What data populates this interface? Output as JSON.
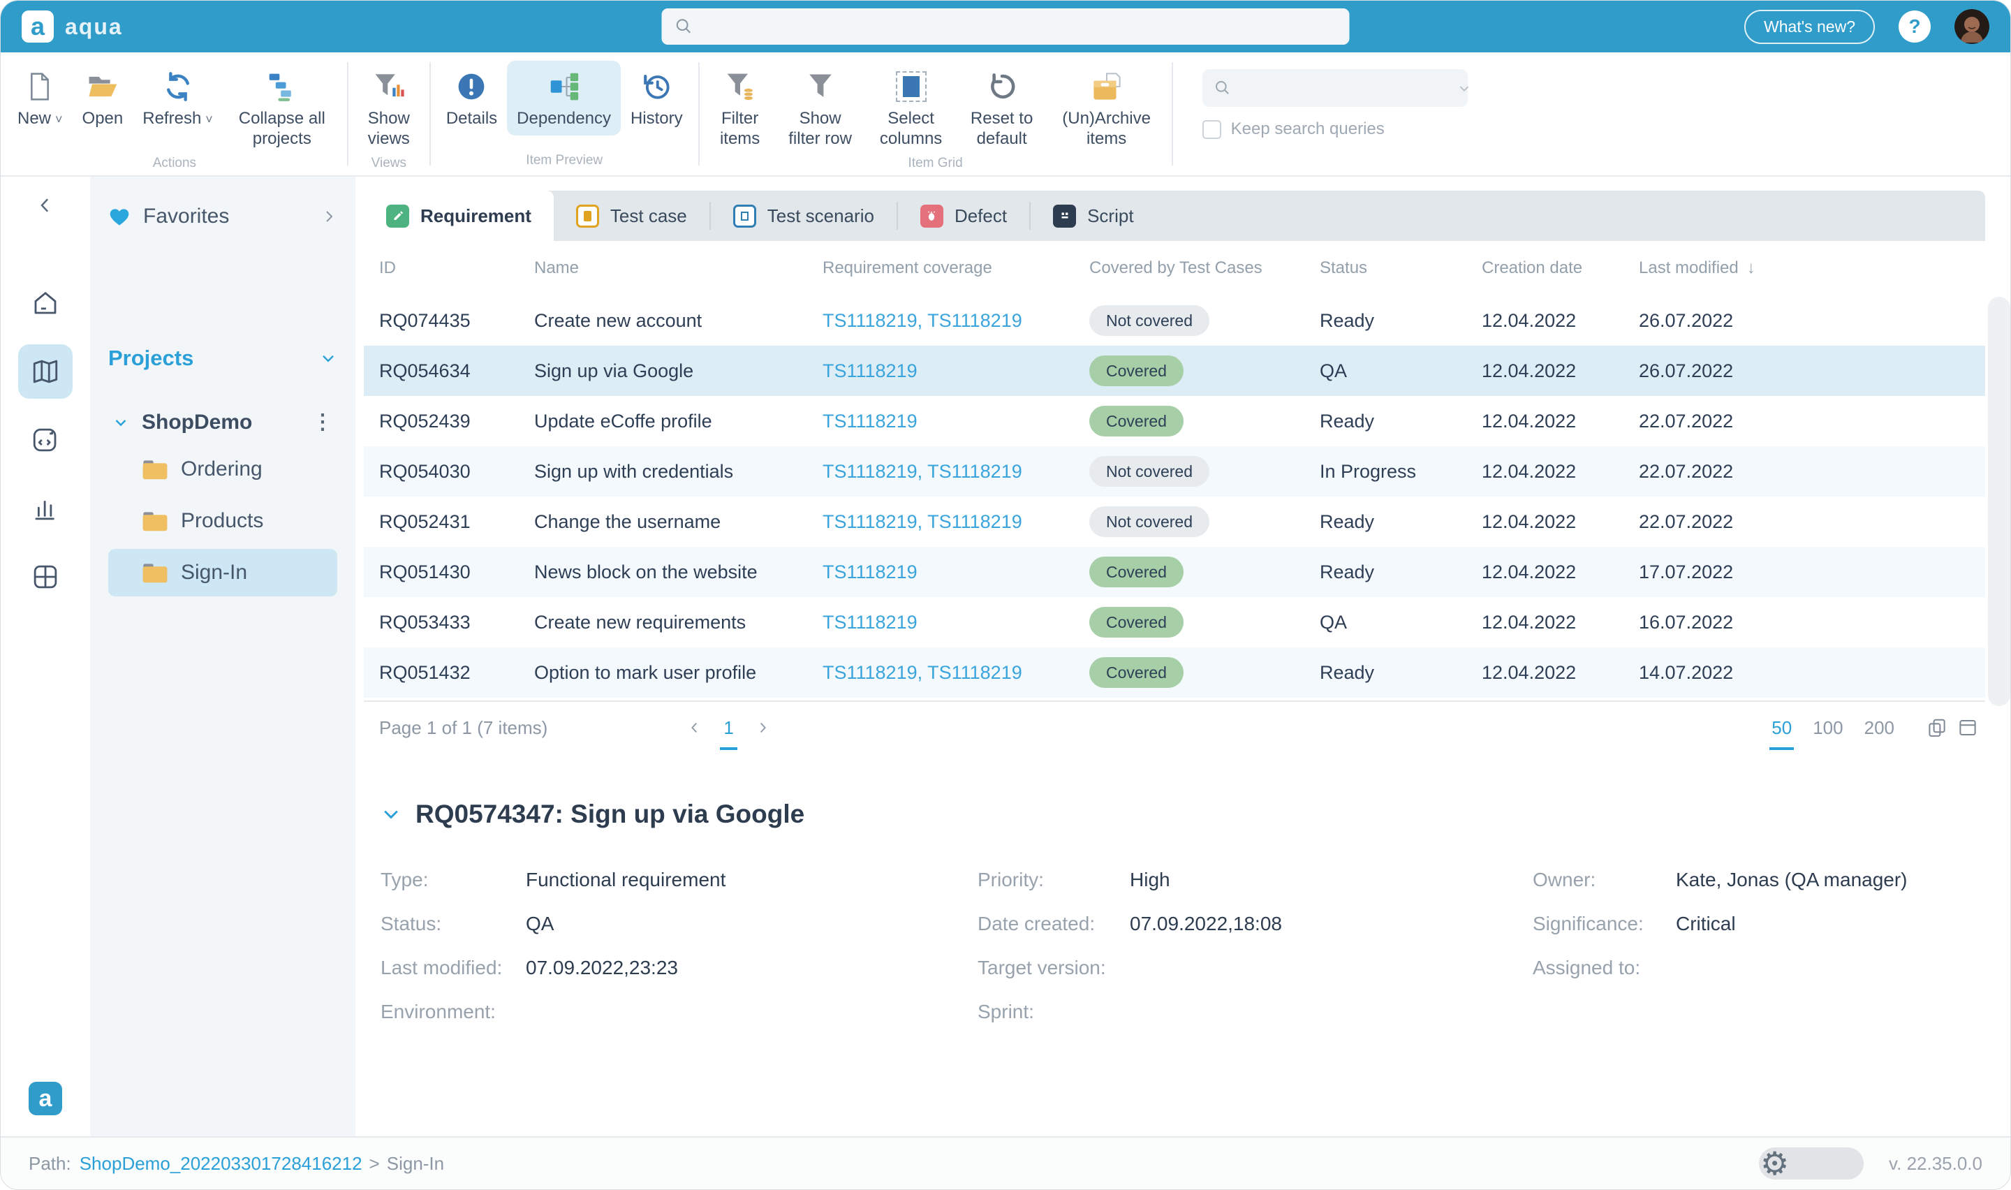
{
  "topbar": {
    "brand": "aqua",
    "search_placeholder": "",
    "whats_new_label": "What's new?",
    "help_label": "?"
  },
  "toolbar": {
    "groups": [
      {
        "label": "Actions",
        "buttons": [
          {
            "label": "New"
          },
          {
            "label": "Open"
          },
          {
            "label": "Refresh"
          },
          {
            "label": "Collapse all projects"
          }
        ]
      },
      {
        "label": "Views",
        "buttons": [
          {
            "label": "Show views"
          }
        ]
      },
      {
        "label": "Item Preview",
        "buttons": [
          {
            "label": "Details"
          },
          {
            "label": "Dependency"
          },
          {
            "label": "History"
          }
        ]
      },
      {
        "label": "Item Grid",
        "buttons": [
          {
            "label": "Filter items"
          },
          {
            "label": "Show filter row"
          },
          {
            "label": "Select columns"
          },
          {
            "label": "Reset to default"
          },
          {
            "label": "(Un)Archive items"
          }
        ]
      }
    ],
    "search_placeholder": "",
    "keep_search_label": "Keep search queries"
  },
  "sidebar": {
    "favorites_label": "Favorites",
    "projects_label": "Projects",
    "tree": {
      "project": "ShopDemo",
      "folders": [
        {
          "label": "Ordering",
          "state": "default"
        },
        {
          "label": "Products",
          "state": "default"
        },
        {
          "label": "Sign-In",
          "state": "selected"
        }
      ]
    }
  },
  "tabs": [
    {
      "label": "Requirement",
      "state": "active"
    },
    {
      "label": "Test case",
      "state": "default"
    },
    {
      "label": "Test scenario",
      "state": "default"
    },
    {
      "label": "Defect",
      "state": "default"
    },
    {
      "label": "Script",
      "state": "default"
    }
  ],
  "table": {
    "columns": [
      "ID",
      "Name",
      "Requirement coverage",
      "Covered by Test Cases",
      "Status",
      "Creation date",
      "Last modified"
    ],
    "rows": [
      {
        "id": "RQ074435",
        "name": "Create new account",
        "coverage": "TS1118219, TS1118219",
        "covered_label": "Not covered",
        "covered_state": "not_covered",
        "status": "Ready",
        "created": "12.04.2022",
        "modified": "26.07.2022",
        "state": "default"
      },
      {
        "id": "RQ054634",
        "name": "Sign up via Google",
        "coverage": "TS1118219",
        "covered_label": "Covered",
        "covered_state": "covered",
        "status": "QA",
        "created": "12.04.2022",
        "modified": "26.07.2022",
        "state": "selected"
      },
      {
        "id": "RQ052439",
        "name": "Update eCoffe profile",
        "coverage": "TS1118219",
        "covered_label": "Covered",
        "covered_state": "covered",
        "status": "Ready",
        "created": "12.04.2022",
        "modified": "22.07.2022",
        "state": "default"
      },
      {
        "id": "RQ054030",
        "name": "Sign up with credentials",
        "coverage": "TS1118219, TS1118219",
        "covered_label": "Not covered",
        "covered_state": "not_covered",
        "status": "In Progress",
        "created": "12.04.2022",
        "modified": "22.07.2022",
        "state": "default"
      },
      {
        "id": "RQ052431",
        "name": "Change the username",
        "coverage": "TS1118219, TS1118219",
        "covered_label": "Not covered",
        "covered_state": "not_covered",
        "status": "Ready",
        "created": "12.04.2022",
        "modified": "22.07.2022",
        "state": "default"
      },
      {
        "id": "RQ051430",
        "name": "News block on the website",
        "coverage": "TS1118219",
        "covered_label": "Covered",
        "covered_state": "covered",
        "status": "Ready",
        "created": "12.04.2022",
        "modified": "17.07.2022",
        "state": "default"
      },
      {
        "id": "RQ053433",
        "name": "Create new requirements",
        "coverage": "TS1118219",
        "covered_label": "Covered",
        "covered_state": "covered",
        "status": "QA",
        "created": "12.04.2022",
        "modified": "16.07.2022",
        "state": "default"
      },
      {
        "id": "RQ051432",
        "name": "Option to mark user profile",
        "coverage": "TS1118219, TS1118219",
        "covered_label": "Covered",
        "covered_state": "covered",
        "status": "Ready",
        "created": "12.04.2022",
        "modified": "14.07.2022",
        "state": "default"
      }
    ]
  },
  "pagination": {
    "summary": "Page 1 of 1 (7 items)",
    "page": "1",
    "sizes": [
      "50",
      "100",
      "200"
    ],
    "active_size": "50"
  },
  "detail": {
    "title": "RQ0574347: Sign up via Google",
    "col1": [
      {
        "label": "Type:",
        "value": "Functional requirement"
      },
      {
        "label": "Status:",
        "value": "QA"
      },
      {
        "label": "Last modified:",
        "value": "07.09.2022,23:23"
      },
      {
        "label": "Environment:",
        "value": ""
      }
    ],
    "col2": [
      {
        "label": "Priority:",
        "value": "High"
      },
      {
        "label": "Date created:",
        "value": "07.09.2022,18:08"
      },
      {
        "label": "Target version:",
        "value": ""
      },
      {
        "label": "Sprint:",
        "value": ""
      }
    ],
    "col3": [
      {
        "label": "Owner:",
        "value": "Kate, Jonas (QA manager)"
      },
      {
        "label": "Significance:",
        "value": "Critical"
      },
      {
        "label": "Assigned to:",
        "value": ""
      }
    ]
  },
  "statusbar": {
    "path_label": "Path:",
    "path_link": "ShopDemo_202203301728416212",
    "path_sep": ">",
    "path_current": "Sign-In",
    "version": "v. 22.35.0.0"
  },
  "colors": {
    "topbar": "#2f9cca",
    "accent_blue": "#2aa0d8",
    "covered_badge": "#a6cfa7",
    "not_covered_badge": "#e7ebee",
    "selected_row": "#dcedf5",
    "selected_nav": "#cde7f4"
  }
}
